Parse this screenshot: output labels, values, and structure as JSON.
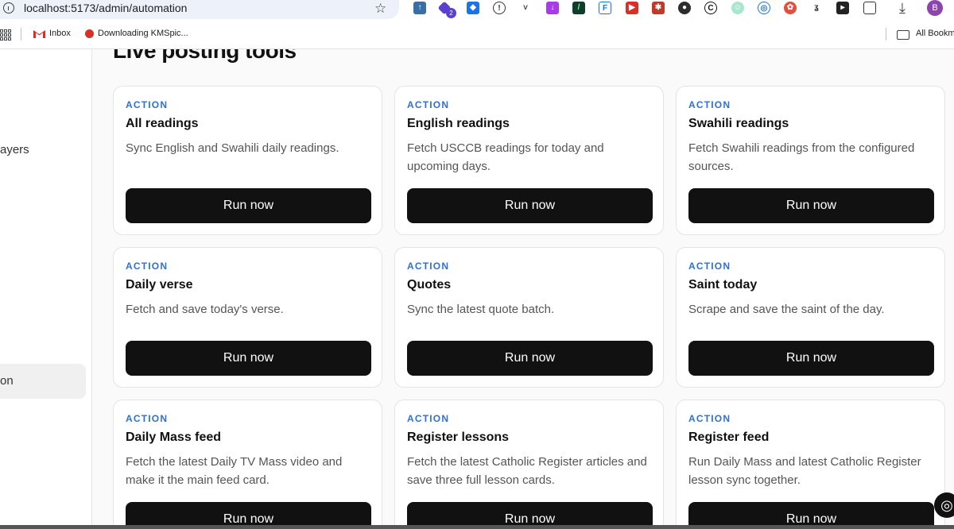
{
  "browser": {
    "url": "localhost:5173/admin/automation",
    "profile_initial": "B",
    "ext_badge": "2",
    "bookmarks": [
      {
        "label": "Inbox"
      },
      {
        "label": "Downloading KMSpic..."
      }
    ],
    "all_bookmarks": "All Bookma"
  },
  "sidebar": {
    "items": [
      {
        "label": "ayers"
      },
      {
        "label": "on"
      }
    ]
  },
  "main": {
    "section_title": "Live posting tools",
    "cards": [
      {
        "tag": "ACTION",
        "title": "All readings",
        "desc": "Sync English and Swahili daily readings.",
        "button": "Run now"
      },
      {
        "tag": "ACTION",
        "title": "English readings",
        "desc": "Fetch USCCB readings for today and upcoming days.",
        "button": "Run now"
      },
      {
        "tag": "ACTION",
        "title": "Swahili readings",
        "desc": "Fetch Swahili readings from the configured sources.",
        "button": "Run now"
      },
      {
        "tag": "ACTION",
        "title": "Daily verse",
        "desc": "Fetch and save today's verse.",
        "button": "Run now"
      },
      {
        "tag": "ACTION",
        "title": "Quotes",
        "desc": "Sync the latest quote batch.",
        "button": "Run now"
      },
      {
        "tag": "ACTION",
        "title": "Saint today",
        "desc": "Scrape and save the saint of the day.",
        "button": "Run now"
      },
      {
        "tag": "ACTION",
        "title": "Daily Mass feed",
        "desc": "Fetch the latest Daily TV Mass video and make it the main feed card.",
        "button": "Run now"
      },
      {
        "tag": "ACTION",
        "title": "Register lessons",
        "desc": "Fetch the latest Catholic Register articles and save three full lesson cards.",
        "button": "Run now"
      },
      {
        "tag": "ACTION",
        "title": "Register feed",
        "desc": "Run Daily Mass and latest Catholic Register lesson sync together.",
        "button": "Run now"
      }
    ]
  },
  "colors": {
    "accent_tag": "#2f6fd6",
    "button_bg": "#111111",
    "profile": "#8e44ad"
  }
}
